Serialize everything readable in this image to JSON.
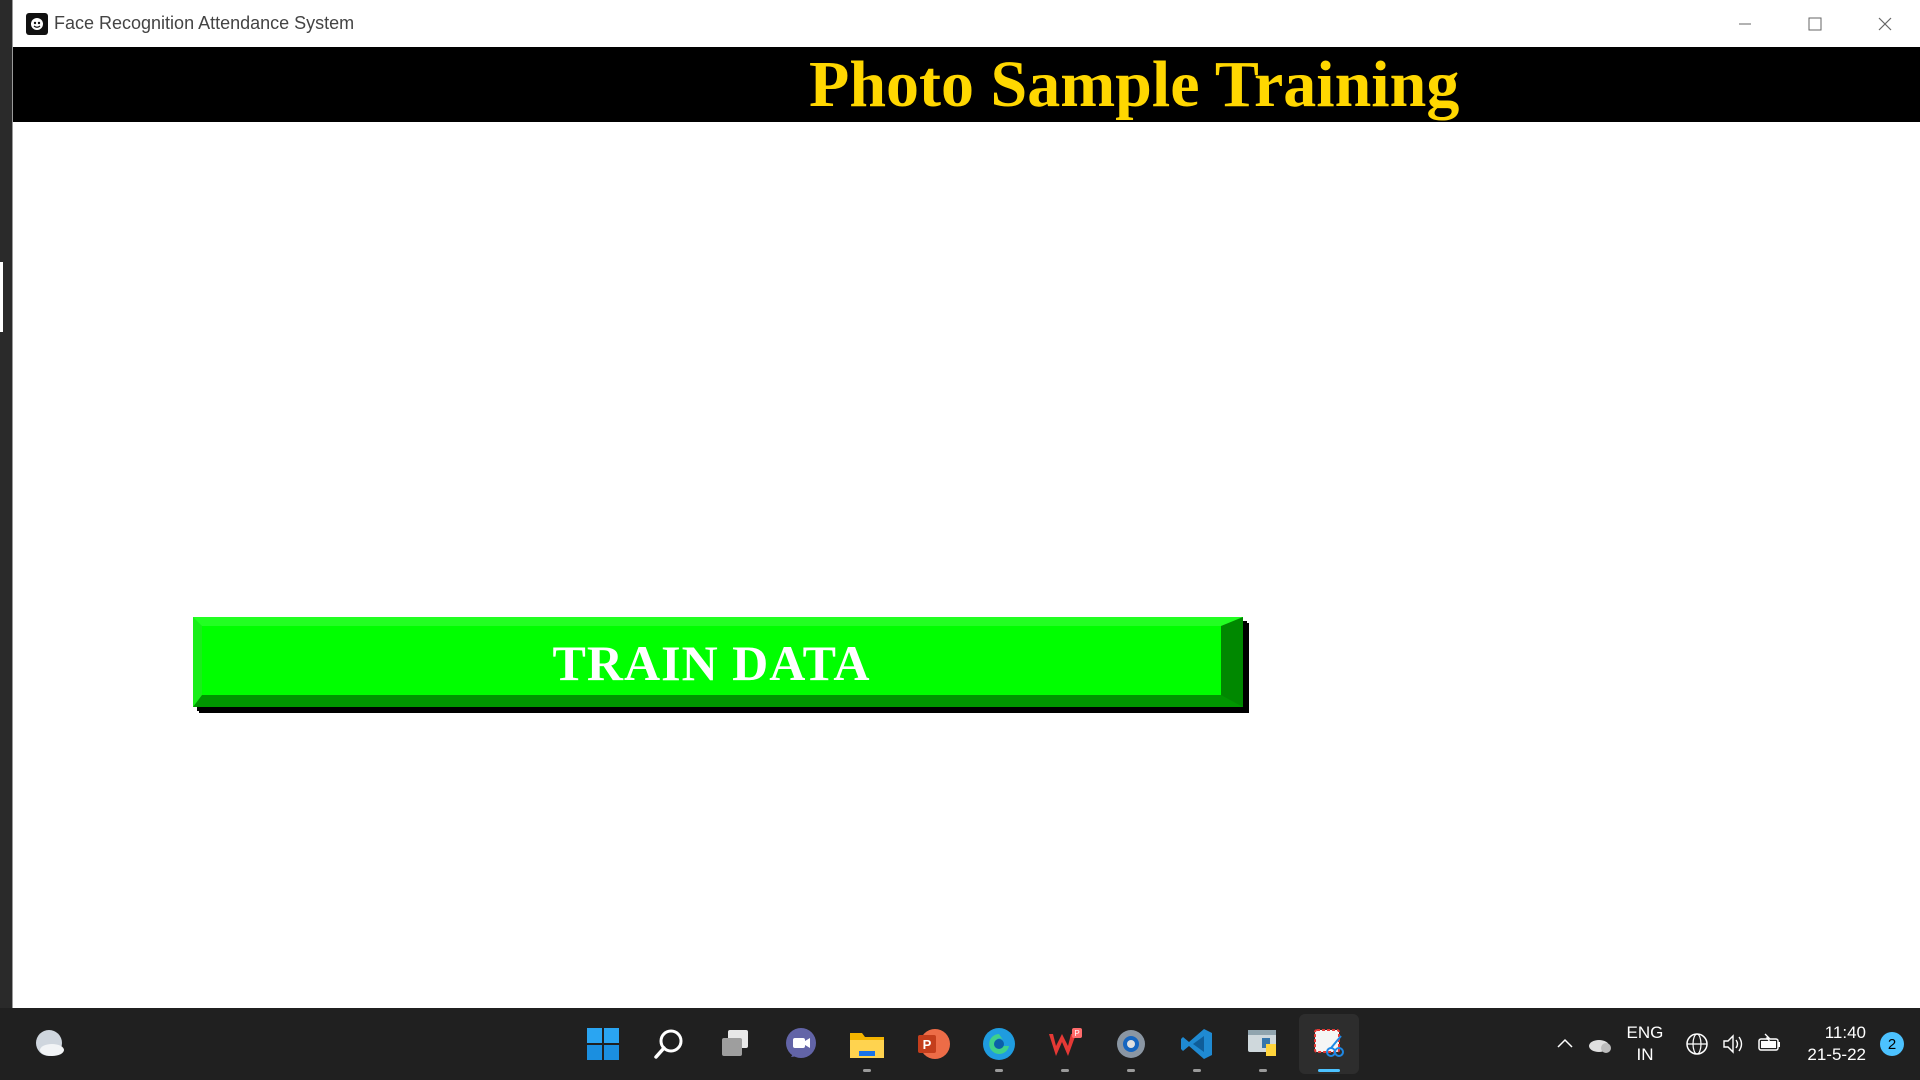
{
  "window": {
    "title": "Face Recognition Attendance System",
    "controls": {
      "minimize": "—",
      "maximize": "☐",
      "close": "✕"
    }
  },
  "header": {
    "title": "Photo Sample Training",
    "title_color": "#ffd700",
    "band_color": "#000000"
  },
  "main": {
    "train_button_label": "TRAIN DATA",
    "train_button_color": "#00ff00"
  },
  "taskbar": {
    "apps": [
      {
        "name": "start-icon"
      },
      {
        "name": "search-icon"
      },
      {
        "name": "task-view-icon"
      },
      {
        "name": "teams-chat-icon"
      },
      {
        "name": "file-explorer-icon"
      },
      {
        "name": "powerpoint-icon"
      },
      {
        "name": "edge-icon"
      },
      {
        "name": "wps-office-icon"
      },
      {
        "name": "settings-icon"
      },
      {
        "name": "vscode-icon"
      },
      {
        "name": "python-icon"
      },
      {
        "name": "snipping-tool-icon"
      }
    ],
    "tray": {
      "language_line1": "ENG",
      "language_line2": "IN",
      "time": "11:40",
      "date": "21-5-22",
      "notification_count": "2"
    }
  }
}
